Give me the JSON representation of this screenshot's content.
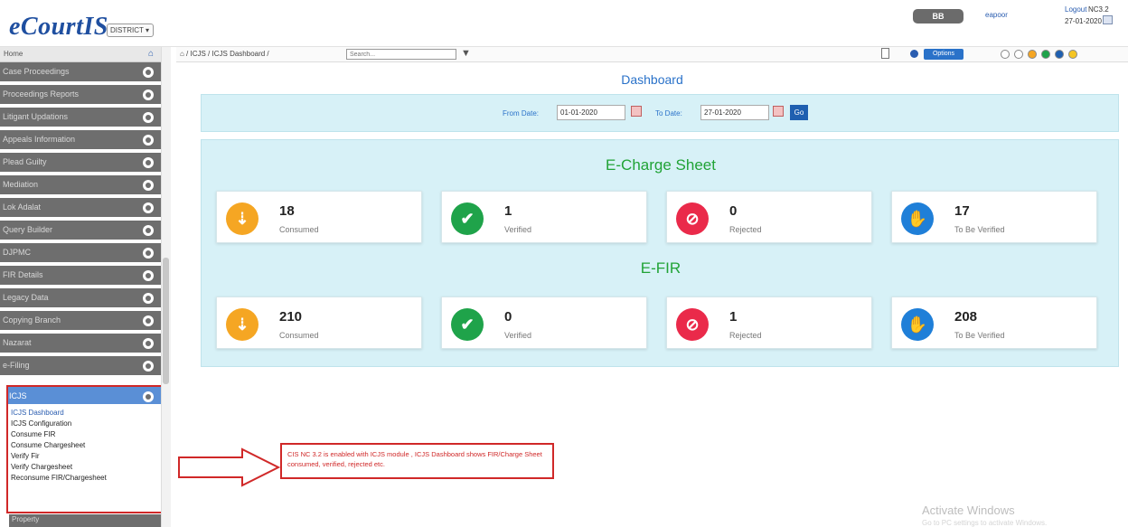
{
  "header": {
    "app_name": "eCourtIS",
    "district_select": "DISTRICT",
    "user_badge": "BB",
    "user_name": "eapoor",
    "logout_label": "Logout",
    "version": "NC3.2",
    "date": "27-01-2020"
  },
  "sidebar": {
    "home_label": "Home",
    "items": [
      "Case Proceedings",
      "Proceedings Reports",
      "Litigant Updations",
      "Appeals Information",
      "Plead Guilty",
      "Mediation",
      "Lok Adalat",
      "Query Builder",
      "DJPMC",
      "FIR Details",
      "Legacy Data",
      "Copying Branch",
      "Nazarat",
      "e-Filing",
      "ICJS"
    ],
    "icjs_sub_items": [
      "ICJS Dashboard",
      "ICJS Configuration",
      "Consume FIR",
      "Consume Chargesheet",
      "Verify Fir",
      "Verify Chargesheet",
      "Reconsume FIR/Chargesheet"
    ],
    "last_item": "Property"
  },
  "toolbar": {
    "breadcrumb": "⌂ / ICJS / ICJS Dashboard /",
    "search_placeholder": "Search...",
    "options_label": "Options",
    "theme_dots": [
      "#ffffff",
      "#ffffff",
      "#f5a623",
      "#1fa34a",
      "#1f5fb0",
      "#f5c523"
    ]
  },
  "dashboard": {
    "title": "Dashboard",
    "from_label": "From Date:",
    "from_value": "01-01-2020",
    "to_label": "To Date:",
    "to_value": "27-01-2020",
    "go_label": "Go"
  },
  "charge_sheet": {
    "title": "E-Charge Sheet",
    "cards": [
      {
        "value": "18",
        "label": "Consumed",
        "icon": "download-cloud-icon",
        "color": "#f5a623"
      },
      {
        "value": "1",
        "label": "Verified",
        "icon": "check-icon",
        "color": "#1fa34a"
      },
      {
        "value": "0",
        "label": "Rejected",
        "icon": "ban-icon",
        "color": "#ea2a4a"
      },
      {
        "value": "17",
        "label": "To Be Verified",
        "icon": "hand-icon",
        "color": "#1f7fd8"
      }
    ]
  },
  "efir": {
    "title": "E-FIR",
    "cards": [
      {
        "value": "210",
        "label": "Consumed",
        "icon": "download-cloud-icon",
        "color": "#f5a623"
      },
      {
        "value": "0",
        "label": "Verified",
        "icon": "check-icon",
        "color": "#1fa34a"
      },
      {
        "value": "1",
        "label": "Rejected",
        "icon": "ban-icon",
        "color": "#ea2a4a"
      },
      {
        "value": "208",
        "label": "To Be Verified",
        "icon": "hand-icon",
        "color": "#1f7fd8"
      }
    ]
  },
  "callout": {
    "text": "CIS NC 3.2 is enabled with ICJS module , ICJS Dashboard shows FIR/Charge Sheet consumed, verified, rejected etc."
  },
  "watermark": {
    "title": "Activate Windows",
    "subtitle": "Go to PC settings to activate Windows."
  }
}
